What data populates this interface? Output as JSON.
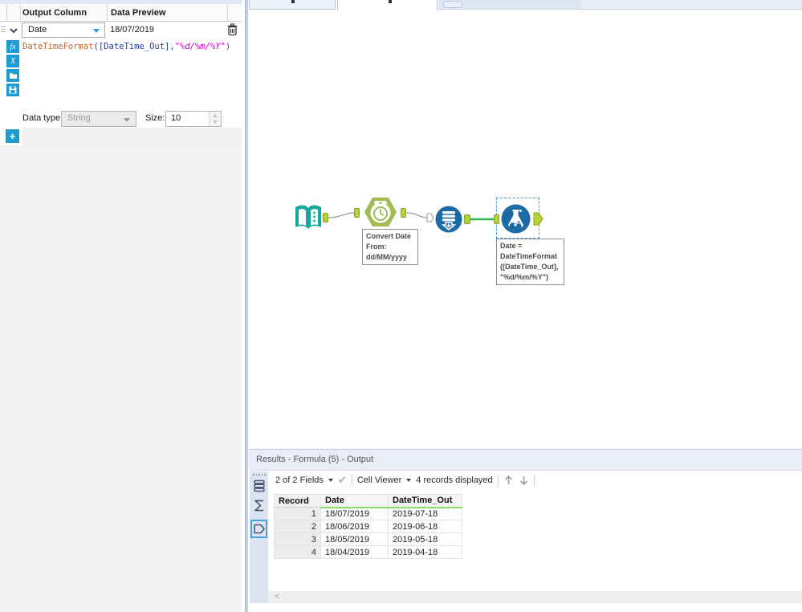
{
  "formula_panel": {
    "header": {
      "output_column": "Output Column",
      "data_preview": "Data Preview"
    },
    "row": {
      "output_column_value": "Date",
      "preview": "18/07/2019"
    },
    "toolbar": {
      "fx_label": "fx",
      "x_label": "X"
    },
    "expression": {
      "func": "DateTimeFormat",
      "open": "([",
      "field": "DateTime_Out",
      "mid": "],",
      "str": "\"%d/%m/%Y\"",
      "close": ")"
    },
    "datatype": {
      "label": "Data type:",
      "value": "String",
      "size_label": "Size:",
      "size_value": "10"
    },
    "add_label": "+"
  },
  "canvas": {
    "datetime_annotation": [
      "Convert Date",
      "From:",
      "dd/MM/yyyy"
    ],
    "formula_annotation": [
      "Date =",
      "DateTimeFormat",
      "([DateTime_Out],",
      "\"%d/%m/%Y\")"
    ]
  },
  "results": {
    "title": "Results - Formula (5) - Output",
    "toolbar": {
      "fields": "2 of 2 Fields",
      "cell_viewer": "Cell Viewer",
      "records": "4 records displayed"
    },
    "table": {
      "columns": [
        "Record",
        "Date",
        "DateTime_Out"
      ],
      "rows": [
        [
          "1",
          "18/07/2019",
          "2019-07-18"
        ],
        [
          "2",
          "18/06/2019",
          "2019-06-18"
        ],
        [
          "3",
          "18/05/2019",
          "2019-05-18"
        ],
        [
          "4",
          "18/04/2019",
          "2019-04-18"
        ]
      ]
    },
    "hscroll_chevron": "<"
  },
  "colors": {
    "accent_blue": "#1d9bd2",
    "anchor_green": "#b2d235",
    "wire_selected": "#2fb34a",
    "header_underline": "#8de06a",
    "tool_teal": "#16a79f",
    "tool_olive": "#a2bc53",
    "tool_navy": "#1d6ba5"
  }
}
